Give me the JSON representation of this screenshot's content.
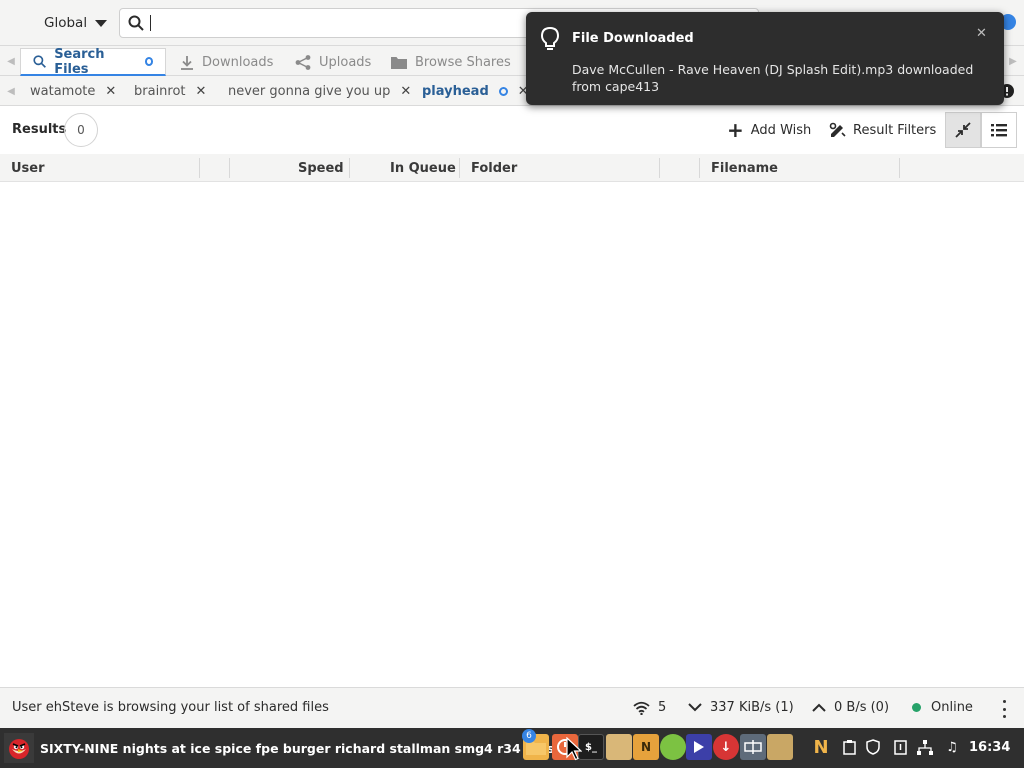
{
  "search": {
    "mode": "Global",
    "value": "",
    "placeholder": ""
  },
  "tabs": [
    {
      "label": "Search Files",
      "badge": "0"
    },
    {
      "label": "Downloads"
    },
    {
      "label": "Uploads"
    },
    {
      "label": "Browse Shares"
    }
  ],
  "search_terms": [
    {
      "label": "watamote"
    },
    {
      "label": "brainrot"
    },
    {
      "label": "never gonna give you up"
    },
    {
      "label": "playhead",
      "badge": "0"
    }
  ],
  "results": {
    "label": "Results",
    "count": "0",
    "add_wish_label": "Add Wish",
    "result_filters_label": "Result Filters"
  },
  "columns": {
    "user": "User",
    "speed": "Speed",
    "in_queue": "In Queue",
    "folder": "Folder",
    "filename": "Filename"
  },
  "status": {
    "message": "User ehSteve is browsing your list of shared files",
    "connections": "5",
    "download_speed": "337 KiB/s (1)",
    "upload_speed": "0 B/s (0)",
    "online_label": "Online",
    "online_color": "#26a269"
  },
  "notification": {
    "title": "File Downloaded",
    "body": "Dave McCullen - Rave Heaven (DJ Splash Edit).mp3 downloaded from cape413"
  },
  "taskbar": {
    "window_title": "SIXTY-NINE nights at ice spice fpe burger richard stallman smg4 r34 stash",
    "badge_count": "6",
    "clock": "16:34"
  },
  "colors": {
    "accent": "#3584e4",
    "active_tab_text": "#2a5f96",
    "notification_bg": "#2d2d2d",
    "taskbar_bg": "#2f2f2f"
  }
}
